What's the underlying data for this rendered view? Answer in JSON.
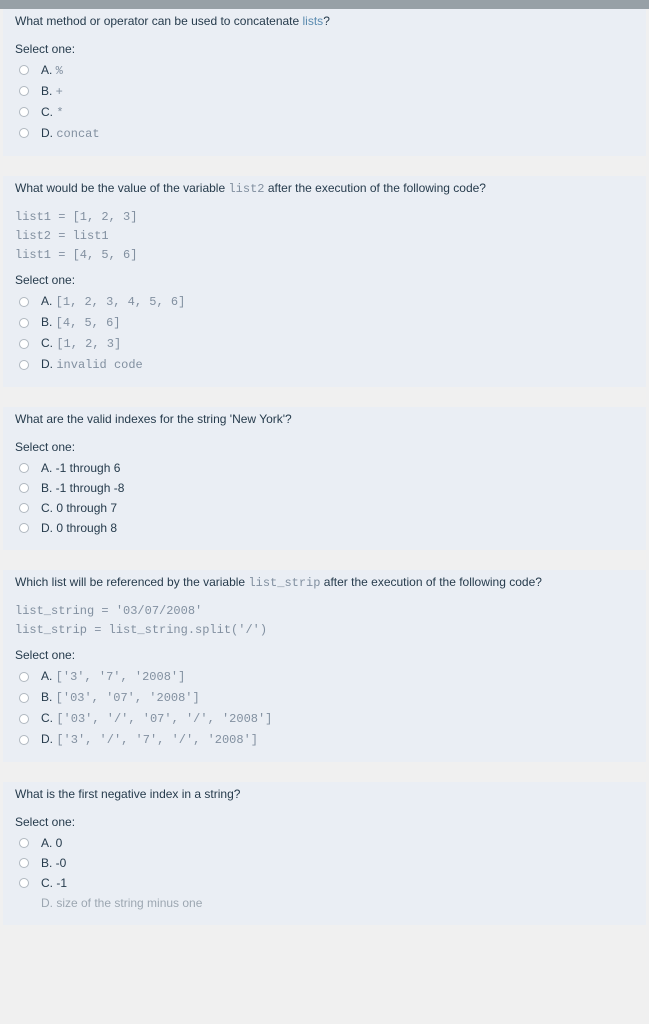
{
  "q1": {
    "text_pre": "What method or operator can be used to concatenate ",
    "link": "lists",
    "text_post": "?",
    "select": "Select one:",
    "opts": [
      {
        "label": "A. ",
        "code": "%"
      },
      {
        "label": "B. ",
        "code": "+"
      },
      {
        "label": "C. ",
        "code": "*"
      },
      {
        "label": "D. ",
        "code": "concat"
      }
    ]
  },
  "q2": {
    "text_pre": "What would be the value of the variable ",
    "var": "list2",
    "text_post": " after the execution of the following code?",
    "code": "list1 = [1, 2, 3]\nlist2 = list1\nlist1 = [4, 5, 6]",
    "select": "Select one:",
    "opts": [
      {
        "label": "A. ",
        "code": "[1, 2, 3, 4, 5, 6]"
      },
      {
        "label": "B. ",
        "code": "[4, 5, 6]"
      },
      {
        "label": "C. ",
        "code": "[1, 2, 3]"
      },
      {
        "label": "D. ",
        "code": "invalid code"
      }
    ]
  },
  "q3": {
    "text": "What are the valid indexes for the string 'New York'?",
    "select": "Select one:",
    "opts": [
      {
        "label": "A. -1 through 6"
      },
      {
        "label": "B. -1 through -8"
      },
      {
        "label": "C. 0 through 7"
      },
      {
        "label": "D. 0 through 8"
      }
    ]
  },
  "q4": {
    "text_pre": "Which list will be referenced by the variable ",
    "var": "list_strip",
    "text_post": " after the execution of the following code?",
    "code": "list_string = '03/07/2008'\nlist_strip = list_string.split('/')",
    "select": "Select one:",
    "opts": [
      {
        "label": "A. ",
        "code": "['3', '7', '2008']"
      },
      {
        "label": "B. ",
        "code": "['03', '07', '2008']"
      },
      {
        "label": "C. ",
        "code": "['03', '/', '07', '/', '2008']"
      },
      {
        "label": "D. ",
        "code": "['3', '/', '7', '/', '2008']"
      }
    ]
  },
  "q5": {
    "text": "What is the first negative index in a string?",
    "select": "Select one:",
    "opts": [
      {
        "label": "A. 0"
      },
      {
        "label": "B. -0"
      },
      {
        "label": "C. -1"
      },
      {
        "label": "D. size of the string minus one"
      }
    ]
  }
}
